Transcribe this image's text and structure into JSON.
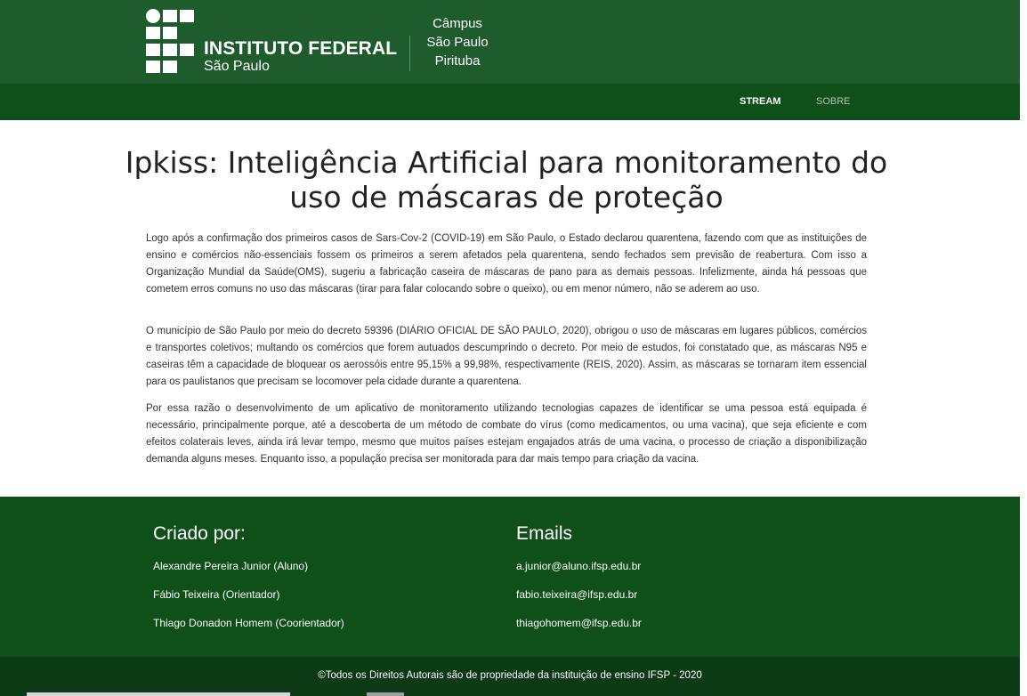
{
  "header": {
    "logo": {
      "name": "INSTITUTO FEDERAL",
      "subtitle": "São Paulo"
    },
    "campus": {
      "line1": "Câmpus",
      "line2": "São Paulo",
      "line3": "Pirituba"
    },
    "colors": {
      "top": "#1e5b2d",
      "nav": "#0f4f1a"
    }
  },
  "nav": {
    "items": [
      {
        "label": "STREAM",
        "active": true
      },
      {
        "label": "SOBRE",
        "active": false
      }
    ]
  },
  "main": {
    "title": "Ipkiss: Inteligência Artificial para monitoramento do uso de máscaras de proteção",
    "paragraphs": [
      "Logo após a confirmação dos primeiros casos de Sars-Cov-2 (COVID-19) em São Paulo, o Estado declarou quarentena, fazendo com que as instituições de ensino e comércios não-essenciais fossem os primeiros a serem afetados pela quarentena, sendo fechados sem previsão de reabertura. Com isso a Organização Mundial da Saúde(OMS), sugeriu a fabricação caseira de máscaras de pano para as demais pessoas. Infelizmente, ainda há pessoas que cometem erros comuns no uso das máscaras (tirar para falar colocando sobre o queixo), ou em menor número, não se aderem ao uso.",
      "O município de São Paulo por meio do decreto 59396 (DIÁRIO OFICIAL DE SÃO PAULO, 2020), obrigou o uso de máscaras em lugares públicos, comércios e transportes coletivos; multando os comércios que forem autuados descumprindo o decreto. Por meio de estudos, foi constatado que, as máscaras N95 e caseiras têm a capacidade de bloquear os aerossóis entre 95,15% a 99,98%, respectivamente (REIS, 2020). Assim, as máscaras se tornaram item essencial para os paulistanos que precisam se locomover pela cidade durante a quarentena.",
      "Por essa razão o desenvolvimento de um aplicativo de monitoramento utilizando tecnologias capazes de identificar se uma pessoa está equipada é necessário, principalmente porque, até a descoberta de um método de combate do vírus (como medicamentos, ou uma vacina), que seja eficiente e com efeitos colaterais leves, ainda irá levar tempo, mesmo que muitos países estejam engajados atrás de uma vacina, o processo de criação a disponibilização demanda alguns meses. Enquanto isso, a população precisa ser monitorada para dar mais tempo para criação da vacina."
    ]
  },
  "footer": {
    "created_by": {
      "heading": "Criado por:",
      "items": [
        "Alexandre Pereira Junior (Aluno)",
        "Fábio Teixeira (Orientador)",
        "Thiago Donadon Homem (Coorientador)"
      ]
    },
    "emails": {
      "heading": "Emails",
      "items": [
        "a.junior@aluno.ifsp.edu.br",
        "fabio.teixeira@ifsp.edu.br",
        "thiagohomem@ifsp.edu.br"
      ]
    },
    "copyright": "©Todos os Direitos Autorais são de propriedade da instituição de ensino IFSP - 2020",
    "colors": {
      "footer": "#0f4f1a",
      "bottom_bar": "#0b3a14"
    }
  }
}
